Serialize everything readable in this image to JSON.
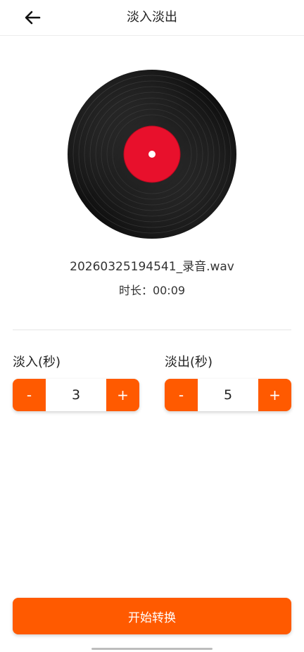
{
  "header": {
    "title": "淡入淡出",
    "back_icon": "arrow-left-icon"
  },
  "file": {
    "name": "20260325194541_录音.wav",
    "duration_text": "时长：00:09"
  },
  "fade_in": {
    "label": "淡入(秒)",
    "value": "3",
    "minus": "-",
    "plus": "+"
  },
  "fade_out": {
    "label": "淡出(秒)",
    "value": "5",
    "minus": "-",
    "plus": "+"
  },
  "actions": {
    "start_label": "开始转换"
  },
  "colors": {
    "accent": "#ff5a00",
    "record_label": "#e8102c",
    "record_body": "#1a1a1a"
  }
}
